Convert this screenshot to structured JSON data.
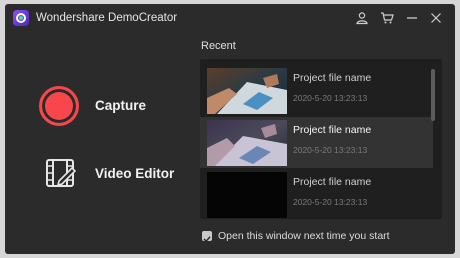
{
  "app": {
    "title": "Wondershare DemoCreator"
  },
  "titlebar_icons": [
    "user-icon",
    "cart-icon",
    "minimize-icon",
    "close-icon"
  ],
  "left_menu": {
    "capture_label": "Capture",
    "video_editor_label": "Video Editor"
  },
  "recent": {
    "title": "Recent",
    "items": [
      {
        "name": "Project file name",
        "date": "2020-5-20 13:23:13",
        "selected": false
      },
      {
        "name": "Project file name",
        "date": "2020-5-20 13:23:13",
        "selected": true
      },
      {
        "name": "Project file name",
        "date": "2020-5-20 13:23:13",
        "selected": false
      }
    ]
  },
  "startup_option": {
    "label": "Open this window next time you start",
    "checked": true
  },
  "colors": {
    "window_bg": "#2b2b2b",
    "panel_bg": "#1f1f1f",
    "capture_red": "#f7474d",
    "selected_row": "#333333"
  }
}
